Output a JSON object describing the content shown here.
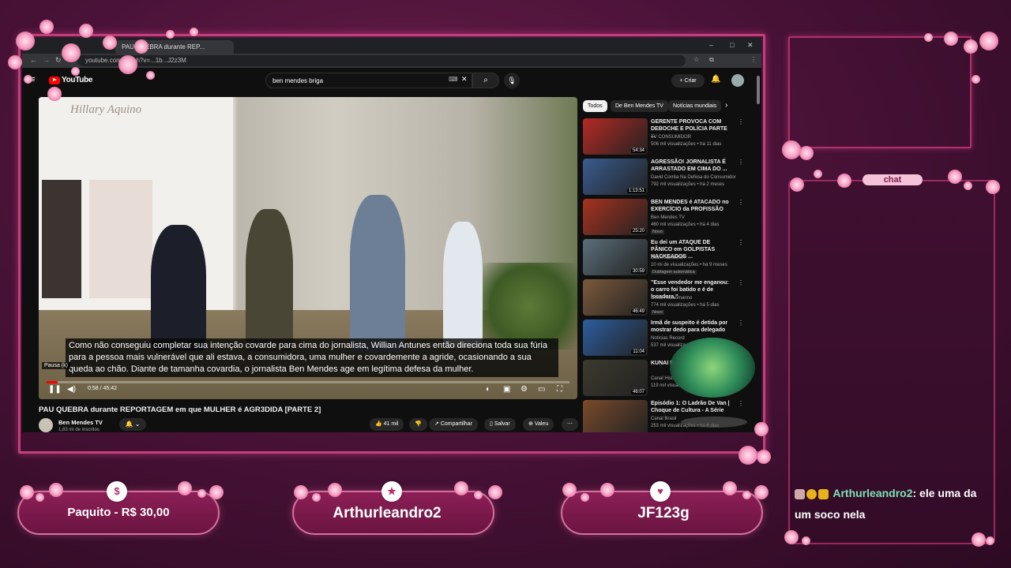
{
  "browser": {
    "tab_title": "PAU QUEBRA durante REP...",
    "address": "youtube.com/watch?v=...1b...J2z3M",
    "window_controls": [
      "–",
      "□",
      "✕"
    ]
  },
  "youtube": {
    "logo_text": "YouTube",
    "search_query": "ben mendes briga",
    "create_label": "Criar",
    "chips": [
      "Todos",
      "De Ben Mendes TV",
      "Notícias mundiais"
    ],
    "video": {
      "store_logo": "Hillary Aquino",
      "subtitle": "Como não conseguiu completar sua intenção covarde para cima do jornalista, Willian Antunes então direciona toda sua fúria para a pessoa mais vulnerável que ali estava, a consumidora, uma mulher e covardemente a agride, ocasionando a sua queda ao chão. Diante de tamanha covardia, o jornalista Ben Mendes age em legítima defesa da mulher.",
      "pause_tip": "Pausa (k)",
      "time": "0:58 / 45:42",
      "progress": 0.021,
      "title": "PAU QUEBRA durante REPORTAGEM em que MULHER é AGR3DIDA [PARTE 2]",
      "channel": "Ben Mendes TV",
      "subscribers": "1,83 mi de inscritos",
      "likes": "41 mil",
      "share_label": "Compartilhar",
      "save_label": "Salvar",
      "thanks_label": "Valeu"
    },
    "recommendations": [
      {
        "title": "GERENTE PROVOCA COM DEBOCHE E POLÍCIA PARTE ...",
        "channel": "TV CONSUMIDOR",
        "meta": "506 mil visualizações • há 11 dias",
        "duration": "54:34",
        "badge": "",
        "color": "#b52a24"
      },
      {
        "title": "AGRESSÃO! JORNALISTA É ARRASTADO EM CIMA DO ...",
        "channel": "David Corrêa Na Defesa do Consumidor",
        "meta": "792 mil visualizações • há 2 meses",
        "duration": "1:13:51",
        "badge": "",
        "color": "#3a5c8f"
      },
      {
        "title": "BEN MENDES é ATACADO no EXERCÍCIO da PROFISSÃO",
        "channel": "Ben Mendes TV",
        "meta": "460 mil visualizações • há 4 dias",
        "duration": "25:20",
        "badge": "Novo",
        "color": "#a8321f"
      },
      {
        "title": "Eu dei um ATAQUE DE PÂNICO em GOLPISTAS HACKEADOS ...",
        "channel": "Scam Sandwich",
        "meta": "10 mi de visualizações • há 9 meses",
        "duration": "30:59",
        "badge": "Dublagem automática",
        "color": "#5b6f7a"
      },
      {
        "title": "\"Esse vendedor me enganou: o carro foi batido e é de locadora.\"",
        "channel": "Celso Russomanno",
        "meta": "774 mil visualizações • há 5 dias",
        "duration": "46:49",
        "badge": "Novo",
        "color": "#7c5a3c"
      },
      {
        "title": "Irmã de suspeito é detida por mostrar dedo para delegado",
        "channel": "Notícias Record",
        "meta": "537 mil visualizações",
        "duration": "11:04",
        "badge": "",
        "color": "#2d5d9e"
      },
      {
        "title": "KUNAI DE NARUTO...",
        "channel": "Canal Hist...",
        "meta": "119 mil visualizações",
        "duration": "46:07",
        "badge": "",
        "color": "#3c3a2e"
      },
      {
        "title": "Episódio 1: O Ladrão De Van | Choque de Cultura - A Série",
        "channel": "Canal Brasil",
        "meta": "253 mil visualizações • há 6 dias",
        "duration": "",
        "badge": "",
        "color": "#7a4a2c"
      }
    ]
  },
  "overlay": {
    "chat_label": "chat",
    "chat_message": {
      "user": "Arthurleandro2",
      "text": ": ele uma da um soco nela"
    },
    "banners": [
      {
        "icon": "$",
        "text": "Paquito - R$ 30,00"
      },
      {
        "icon": "★",
        "text": "Arthurleandro2"
      },
      {
        "icon": "♥",
        "text": "JF123g"
      }
    ],
    "accent_color": "#c2407a",
    "chat_name_color": "#7de3b6"
  }
}
